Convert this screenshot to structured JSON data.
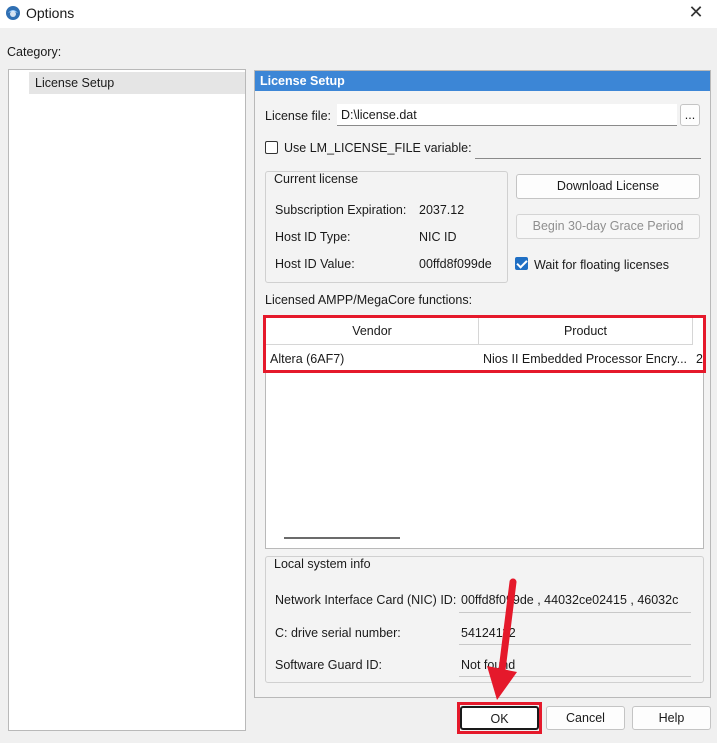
{
  "window": {
    "title": "Options",
    "close_glyph": "✕"
  },
  "category": {
    "label": "Category:",
    "items": [
      {
        "label": "License Setup"
      }
    ]
  },
  "panel": {
    "header": "License Setup",
    "license_file": {
      "label": "License file:",
      "value": "D:\\license.dat",
      "browse_label": "..."
    },
    "lm_var": {
      "label": "Use LM_LICENSE_FILE variable:",
      "checked": false,
      "value": ""
    },
    "current_license": {
      "title": "Current license",
      "rows": [
        {
          "label": "Subscription Expiration:",
          "value": "2037.12"
        },
        {
          "label": "Host ID Type:",
          "value": "NIC ID"
        },
        {
          "label": "Host ID Value:",
          "value": "00ffd8f099de"
        }
      ]
    },
    "download_button": "Download License",
    "grace_button": "Begin 30-day Grace Period",
    "wait_floating": {
      "label": "Wait for floating licenses",
      "checked": true
    },
    "ampp": {
      "label": "Licensed AMPP/MegaCore functions:",
      "columns": [
        "Vendor",
        "Product"
      ],
      "rows": [
        {
          "vendor": "Altera (6AF7)",
          "product": "Nios II Embedded Processor Encry...",
          "extra": "2"
        }
      ]
    },
    "local_info": {
      "title": "Local system info",
      "rows": [
        {
          "label": "Network Interface Card (NIC) ID:",
          "value": "00ffd8f099de , 44032ce02415 , 46032c"
        },
        {
          "label": "C: drive serial number:",
          "value": "54124112"
        },
        {
          "label": "Software Guard ID:",
          "value": "Not found"
        }
      ]
    }
  },
  "footer": {
    "ok": "OK",
    "cancel": "Cancel",
    "help": "Help"
  },
  "colors": {
    "header_blue": "#3c86d6",
    "highlight_red": "#e5192b"
  }
}
